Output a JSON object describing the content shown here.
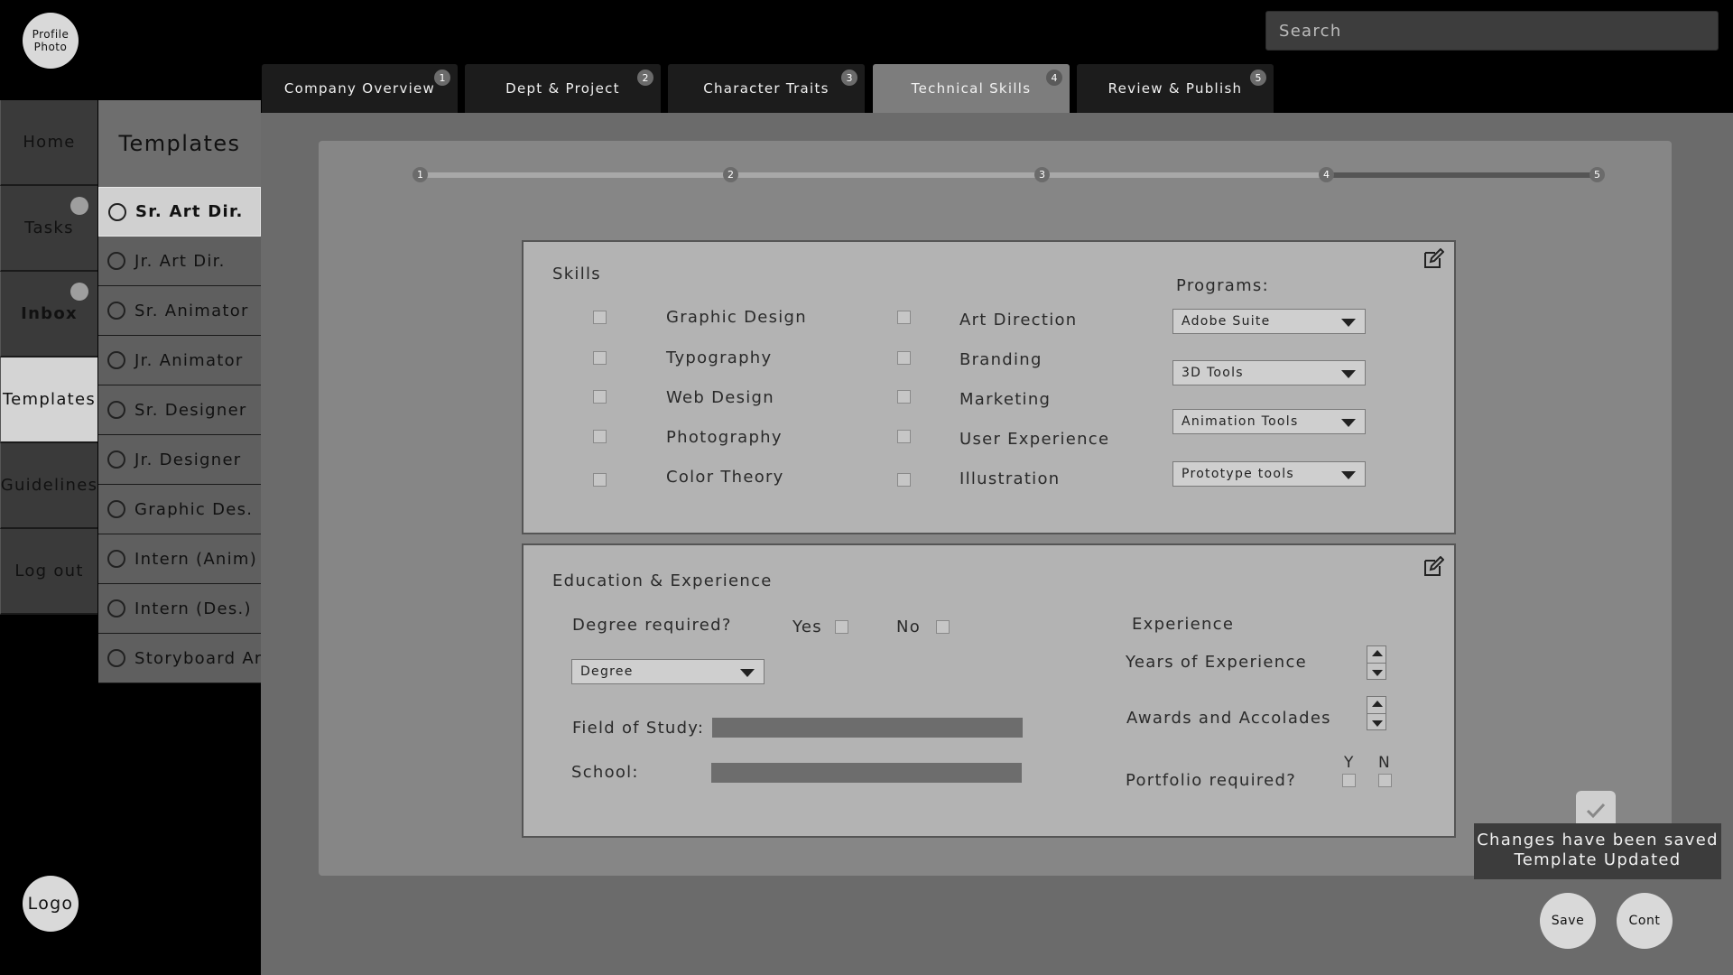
{
  "profile": {
    "line1": "Profile",
    "line2": "Photo"
  },
  "search": {
    "placeholder": "Search"
  },
  "tabs": [
    {
      "label": "Company Overview",
      "badge": "1"
    },
    {
      "label": "Dept & Project",
      "badge": "2"
    },
    {
      "label": "Character Traits",
      "badge": "3"
    },
    {
      "label": "Technical Skills",
      "badge": "4"
    },
    {
      "label": "Review & Publish",
      "badge": "5"
    }
  ],
  "nav": {
    "items": [
      {
        "label": "Home"
      },
      {
        "label": "Tasks"
      },
      {
        "label": "Inbox"
      },
      {
        "label": "Templates"
      },
      {
        "label": "Guidelines"
      },
      {
        "label": "Log out"
      }
    ]
  },
  "templates": {
    "title": "Templates",
    "items": [
      "Sr. Art Dir.",
      "Jr. Art Dir.",
      "Sr. Animator",
      "Jr. Animator",
      "Sr. Designer",
      "Jr. Designer",
      "Graphic Des.",
      "Intern (Anim)",
      "Intern (Des.)",
      "Storyboard Art"
    ]
  },
  "progress": {
    "steps": [
      "1",
      "2",
      "3",
      "4",
      "5"
    ],
    "current_step": 4
  },
  "skills": {
    "title": "Skills",
    "col1": [
      "Graphic Design",
      "Typography",
      "Web Design",
      "Photography",
      "Color Theory"
    ],
    "col2": [
      "Art Direction",
      "Branding",
      "Marketing",
      "User Experience",
      "Illustration"
    ],
    "programs_label": "Programs:",
    "programs": [
      "Adobe Suite",
      "3D Tools",
      "Animation Tools",
      "Prototype tools"
    ]
  },
  "education": {
    "title": "Education & Experience",
    "degree_required": "Degree required?",
    "yes": "Yes",
    "no": "No",
    "degree_select": "Degree",
    "field_of_study": "Field of Study:",
    "school": "School:",
    "experience_title": "Experience",
    "years": "Years of Experience",
    "awards": "Awards and Accolades",
    "portfolio": "Portfolio required?",
    "y": "Y",
    "n": "N"
  },
  "toast": {
    "line1": "Changes have been saved",
    "line2": "Template Updated"
  },
  "buttons": {
    "save": "Save",
    "cont": "Cont"
  },
  "logo": "Logo"
}
